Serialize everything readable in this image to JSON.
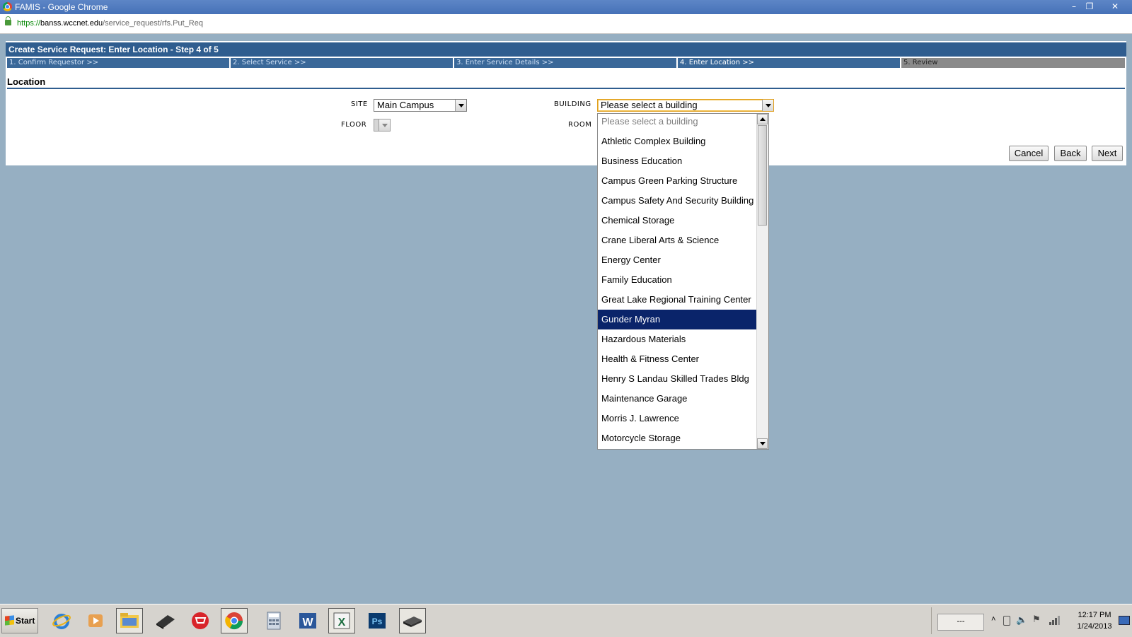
{
  "browser": {
    "title": "FAMIS - Google Chrome",
    "url_scheme": "https://",
    "url_host": "banss.wccnet.edu",
    "url_path": "/service_request/rfs.Put_Req",
    "buttons": [
      "minimize",
      "restore",
      "close"
    ]
  },
  "page": {
    "header": "Create Service Request: Enter Location - Step 4 of 5",
    "steps": [
      {
        "label": "1. Confirm Requestor >>"
      },
      {
        "label": "2. Select Service >>"
      },
      {
        "label": "3. Enter Service Details >>"
      },
      {
        "label": "4. Enter Location >>"
      },
      {
        "label": "5. Review"
      }
    ],
    "section_title": "Location"
  },
  "form": {
    "site_label": "SITE",
    "site_value": "Main Campus",
    "building_label": "BUILDING",
    "building_value": "Please select a building",
    "floor_label": "FLOOR",
    "floor_value": "",
    "room_label": "ROOM"
  },
  "dropdown": {
    "selected_index": 10,
    "options": [
      "Please select a building",
      "Athletic Complex Building",
      "Business Education",
      "Campus Green Parking Structure",
      "Campus Safety And Security Building",
      "Chemical Storage",
      "Crane Liberal Arts & Science",
      "Energy Center",
      "Family Education",
      "Great Lake Regional Training Center",
      "Gunder Myran",
      "Hazardous Materials",
      "Health & Fitness Center",
      "Henry S Landau Skilled Trades Bldg",
      "Maintenance Garage",
      "Morris J. Lawrence",
      "Motorcycle Storage"
    ]
  },
  "actions": {
    "cancel": "Cancel",
    "back": "Back",
    "next": "Next"
  },
  "taskbar": {
    "start_label": "Start",
    "icons": [
      "internet-explorer-icon",
      "media-player-icon",
      "file-explorer-icon",
      "scanner-icon",
      "shopping-cart-icon",
      "chrome-icon",
      "calculator-icon",
      "word-icon",
      "excel-icon",
      "photoshop-icon",
      "drive-icon"
    ],
    "tray_box": "---",
    "clock_time": "12:17 PM",
    "clock_date": "1/24/2013"
  },
  "colors": {
    "header_blue": "#2f5d8f",
    "selection": "#0a246a",
    "desktop": "#96afc2"
  }
}
